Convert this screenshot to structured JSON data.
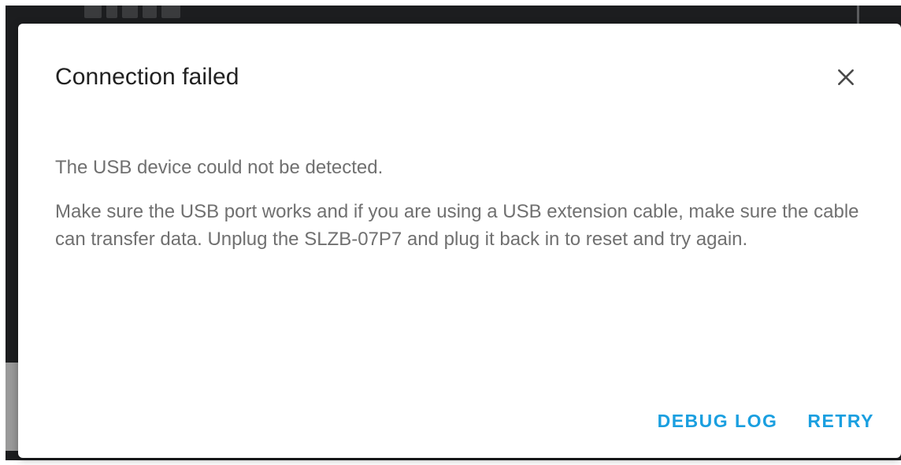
{
  "dialog": {
    "title": "Connection failed",
    "close_icon": "close-icon",
    "paragraphs": [
      "The USB device could not be detected.",
      "Make sure the USB port works and if you are using a USB extension cable, make sure the cable can transfer data. Unplug the SLZB-07P7 and plug it back in to reset and try again."
    ],
    "actions": {
      "debug_log_label": "DEBUG LOG",
      "retry_label": "RETRY"
    }
  },
  "colors": {
    "accent": "#1a9fe0",
    "title_text": "#212121",
    "body_text": "#707070",
    "backdrop": "#1c1d1f",
    "dialog_background": "#ffffff"
  }
}
